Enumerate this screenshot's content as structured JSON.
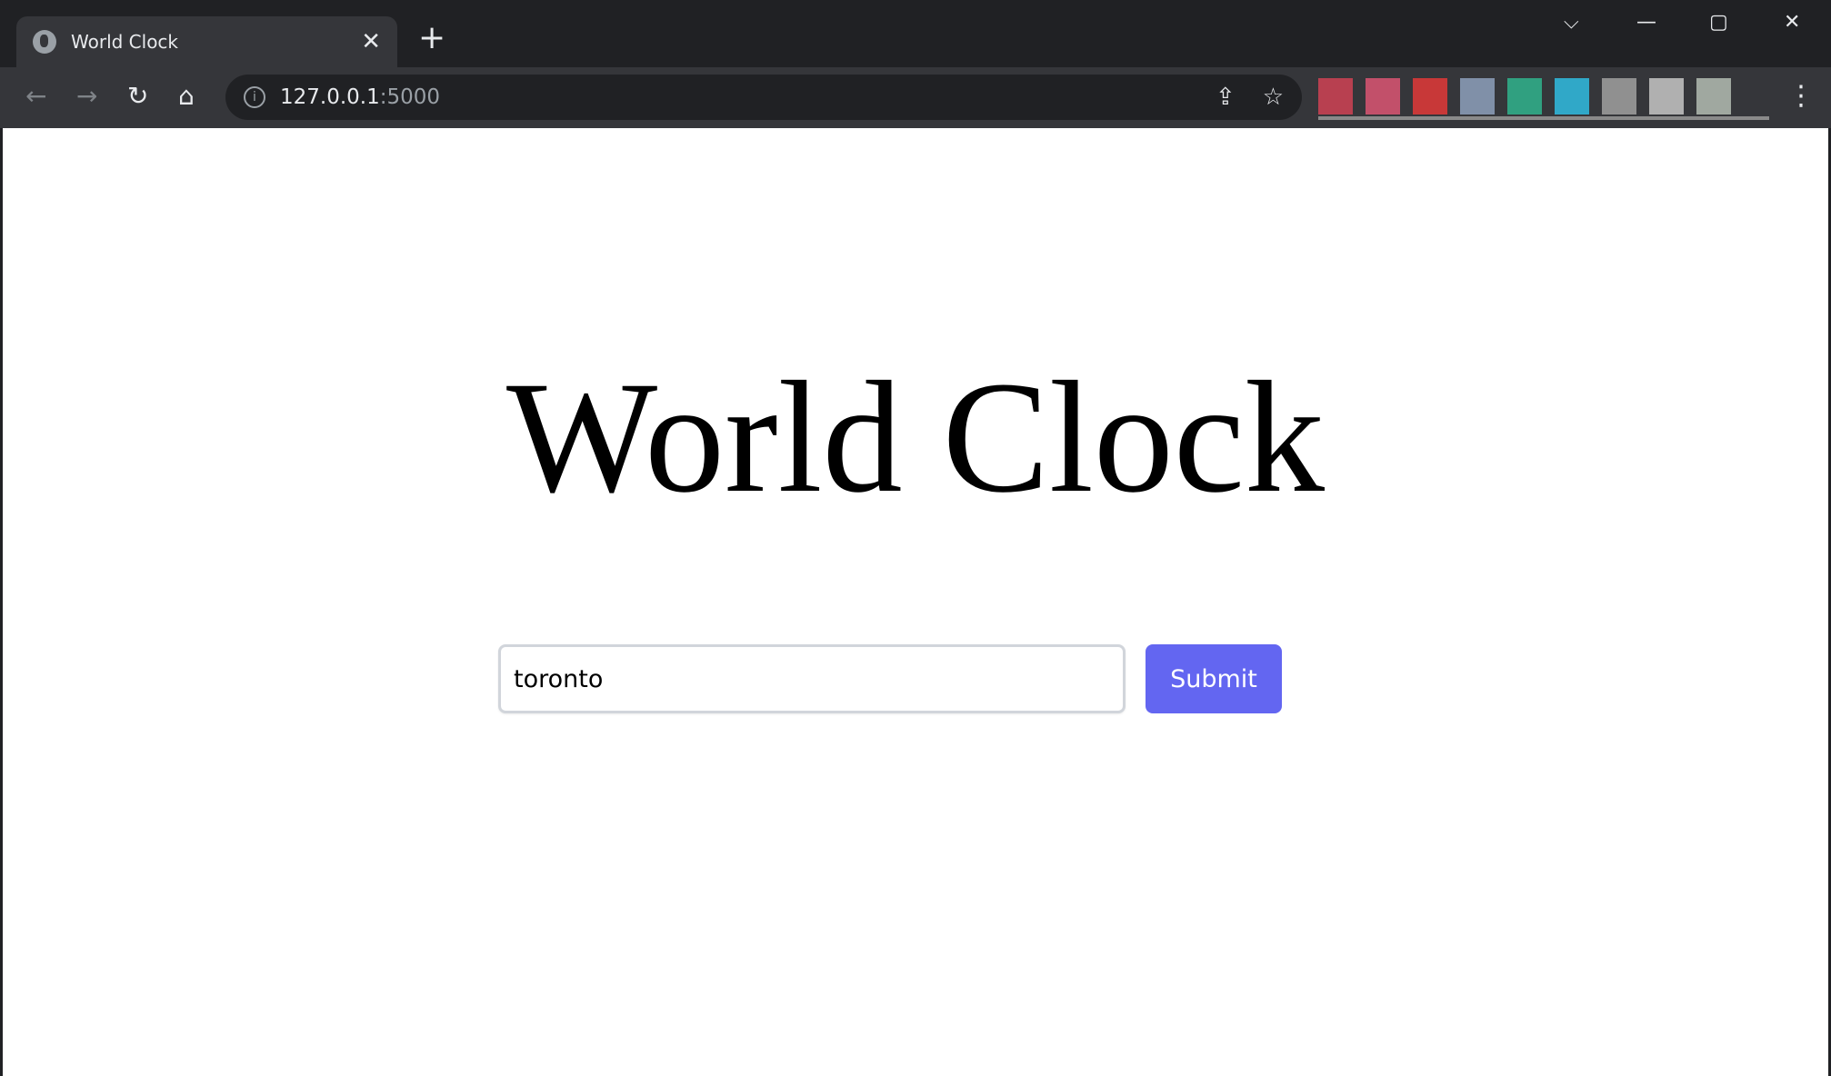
{
  "browser": {
    "tab_title": "World Clock",
    "tab_close": "✕",
    "new_tab": "+",
    "url_host": "127.0.0.1",
    "url_port": ":5000",
    "window_controls": {
      "dropdown": "⌵",
      "minimize": "—",
      "maximize": "▢",
      "close": "✕"
    },
    "nav": {
      "back": "←",
      "forward": "→",
      "reload": "↻",
      "home": "⌂"
    },
    "extension_colors": [
      "#b84050",
      "#c2506a",
      "#c83838",
      "#8090a8",
      "#30a080",
      "#30a8c8",
      "#909090",
      "#b0b0b0",
      "#a0a8a0"
    ]
  },
  "page": {
    "heading": "World Clock",
    "city_input_value": "toronto",
    "submit_label": "Submit",
    "accent": "#6366f1"
  }
}
